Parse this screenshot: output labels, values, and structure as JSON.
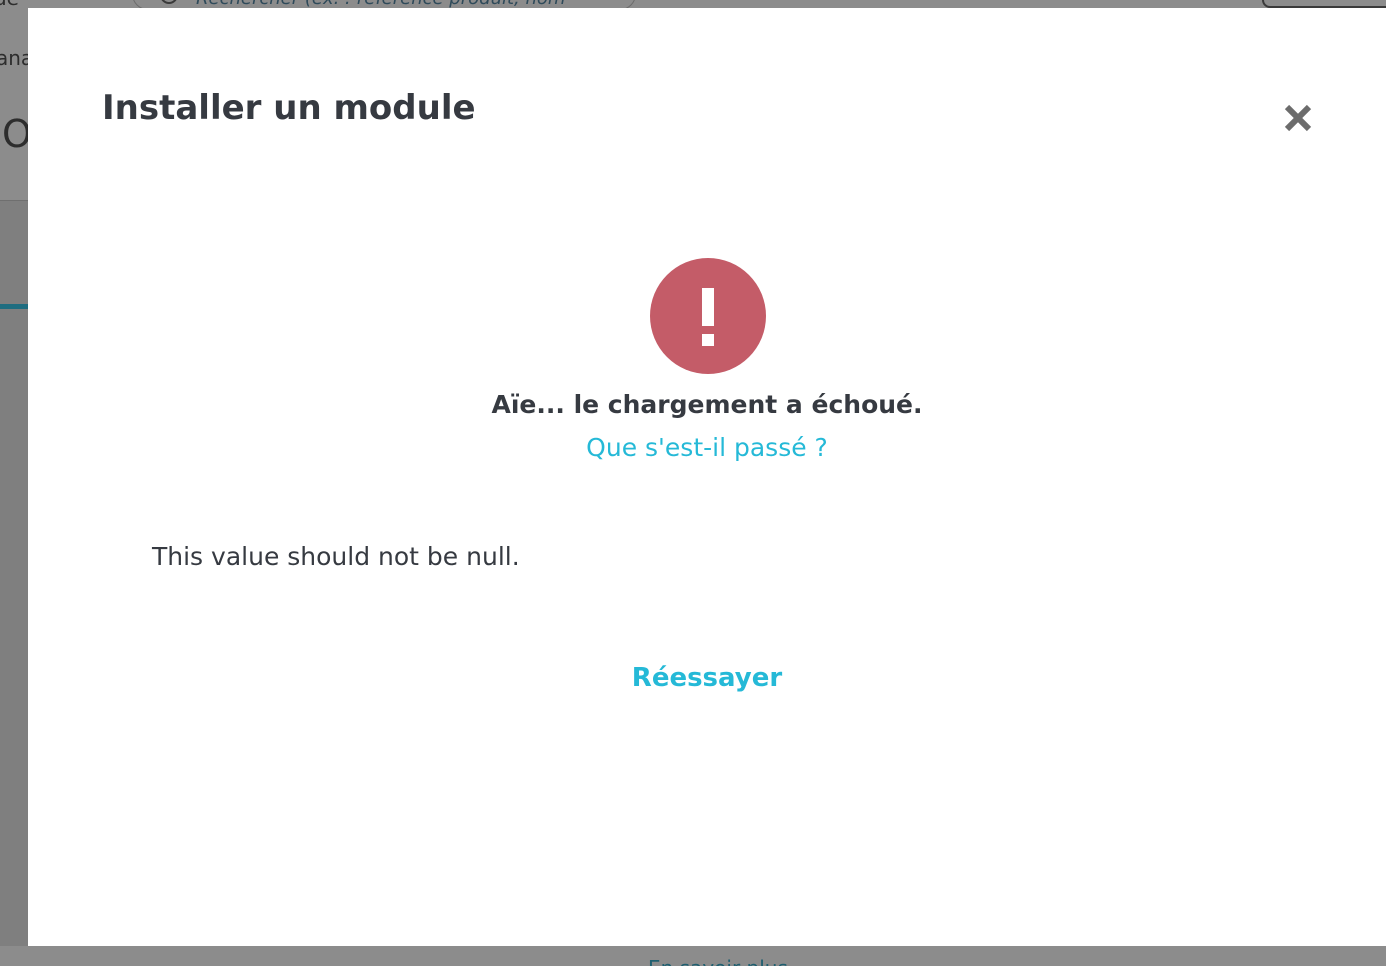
{
  "background": {
    "search_placeholder": "Rechercher (ex. : référence produit, nom",
    "left_label_top": "ue",
    "left_label_mid": "ana",
    "left_label_big": "O",
    "bottom_link": "En savoir plus"
  },
  "modal": {
    "title": "Installer un module",
    "close_icon": "close-icon",
    "error_icon": "exclamation-icon",
    "error_icon_color": "#c45c68",
    "error_heading": "Aïe... le chargement a échoué.",
    "what_happened_link": "Que s'est-il passé ?",
    "error_message": "This value should not be null.",
    "retry_label": "Réessayer",
    "accent_color": "#25b9d7"
  }
}
